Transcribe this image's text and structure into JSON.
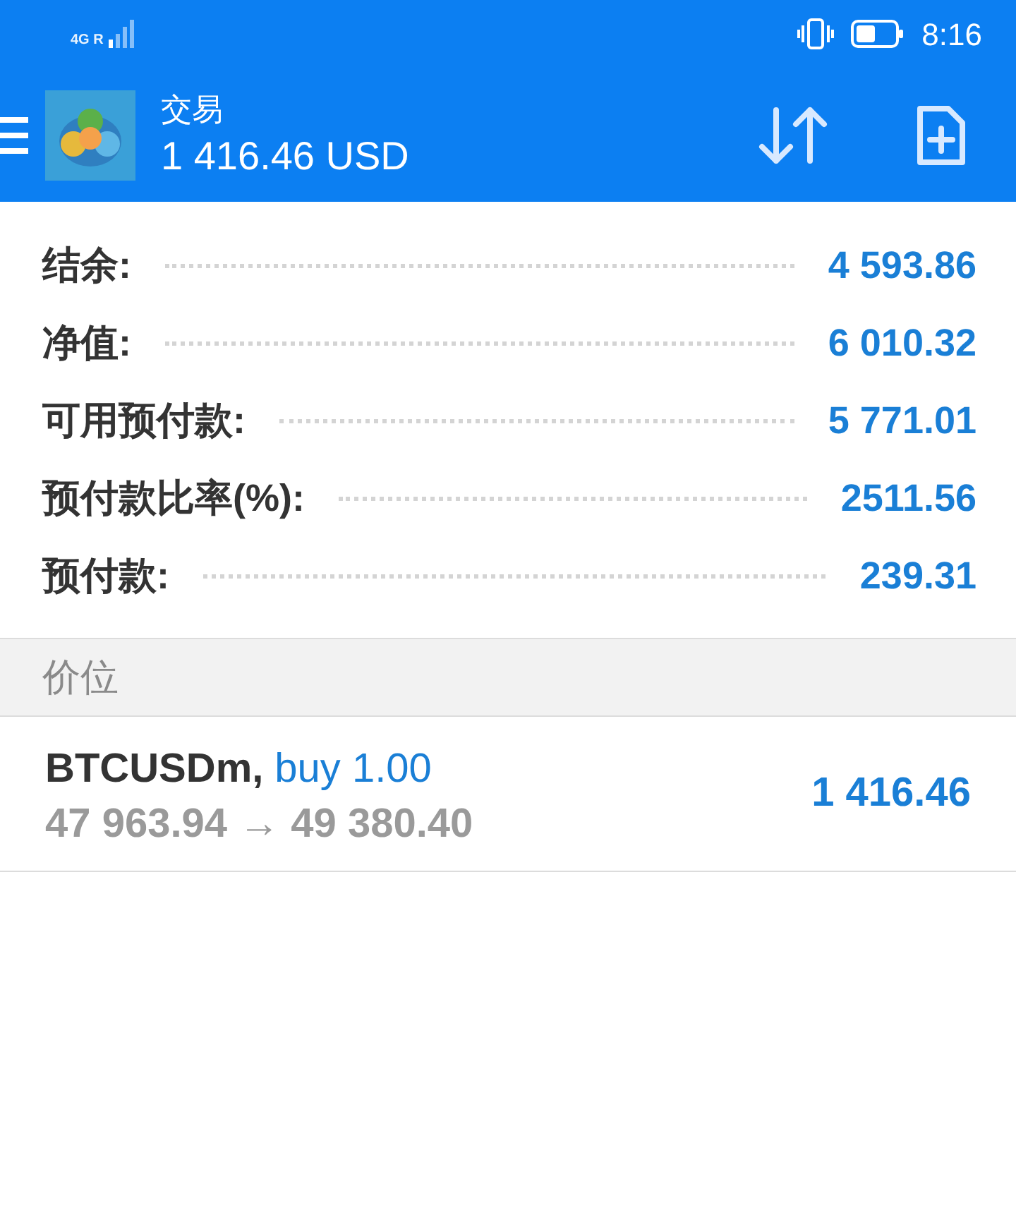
{
  "status_bar": {
    "network": "4G R",
    "time": "8:16"
  },
  "header": {
    "title": "交易",
    "balance": "1 416.46 USD"
  },
  "summary": [
    {
      "label": "结余:",
      "value": "4 593.86"
    },
    {
      "label": "净值:",
      "value": "6 010.32"
    },
    {
      "label": "可用预付款:",
      "value": "5 771.01"
    },
    {
      "label": "预付款比率(%):",
      "value": "2511.56"
    },
    {
      "label": "预付款:",
      "value": "239.31"
    }
  ],
  "section": {
    "title": "价位"
  },
  "positions": [
    {
      "symbol": "BTCUSDm,",
      "order": "buy 1.00",
      "prices": "47 963.94 → 49 380.40",
      "profit": "1 416.46"
    }
  ]
}
